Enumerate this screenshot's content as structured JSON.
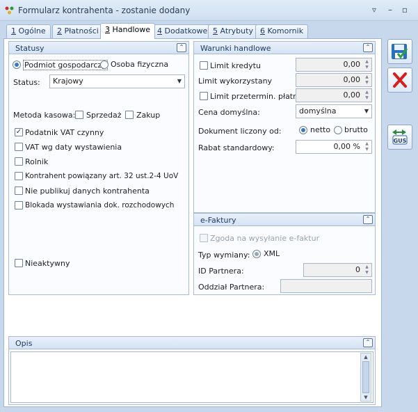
{
  "window": {
    "title": "Formularz kontrahenta - zostanie dodany"
  },
  "tabs": [
    {
      "num": "1",
      "label": "Ogólne"
    },
    {
      "num": "2",
      "label": "Płatności"
    },
    {
      "num": "3",
      "label": "Handlowe"
    },
    {
      "num": "4",
      "label": "Dodatkowe"
    },
    {
      "num": "5",
      "label": "Atrybuty"
    },
    {
      "num": "6",
      "label": "Komornik"
    }
  ],
  "statusy": {
    "title": "Statusy",
    "radio_podmiot": "Podmiot gospodarczy",
    "radio_osoba": "Osoba fizyczna",
    "status_label": "Status:",
    "status_value": "Krajowy",
    "metoda_label": "Metoda kasowa:",
    "sprzedaz": "Sprzedaż",
    "zakup": "Zakup",
    "vat_czynny": "Podatnik VAT czynny",
    "vat_wg_daty": "VAT wg daty wystawienia",
    "rolnik": "Rolnik",
    "powiazany": "Kontrahent powiązany art. 32 ust.2-4 UoV",
    "nie_publikuj": "Nie publikuj danych kontrahenta",
    "blokada": "Blokada wystawiania dok. rozchodowych",
    "nieaktywny": "Nieaktywny"
  },
  "warunki": {
    "title": "Warunki handlowe",
    "limit_kredytu": "Limit kredytu",
    "limit_kredytu_val": "0,00",
    "limit_wykorzystany": "Limit wykorzystany",
    "limit_wykorzystany_val": "0,00",
    "limit_przeterm": "Limit przetermin. płatn.",
    "limit_przeterm_val": "0,00",
    "cena_label": "Cena domyślna:",
    "cena_value": "domyślna",
    "dokument_label": "Dokument liczony od:",
    "netto": "netto",
    "brutto": "brutto",
    "rabat_label": "Rabat standardowy:",
    "rabat_value": "0,00 %"
  },
  "efaktury": {
    "title": "e-Faktury",
    "zgoda": "Zgoda na wysyłanie e-faktur",
    "typ_label": "Typ wymiany:",
    "xml": "XML",
    "id_label": "ID Partnera:",
    "id_value": "0",
    "oddzial_label": "Oddział Partnera:",
    "oddzial_value": ""
  },
  "opis": {
    "title": "Opis",
    "value": ""
  },
  "colors": {
    "accent": "#3a78c8",
    "save": "#2a6fc0",
    "cancel": "#d62020"
  }
}
